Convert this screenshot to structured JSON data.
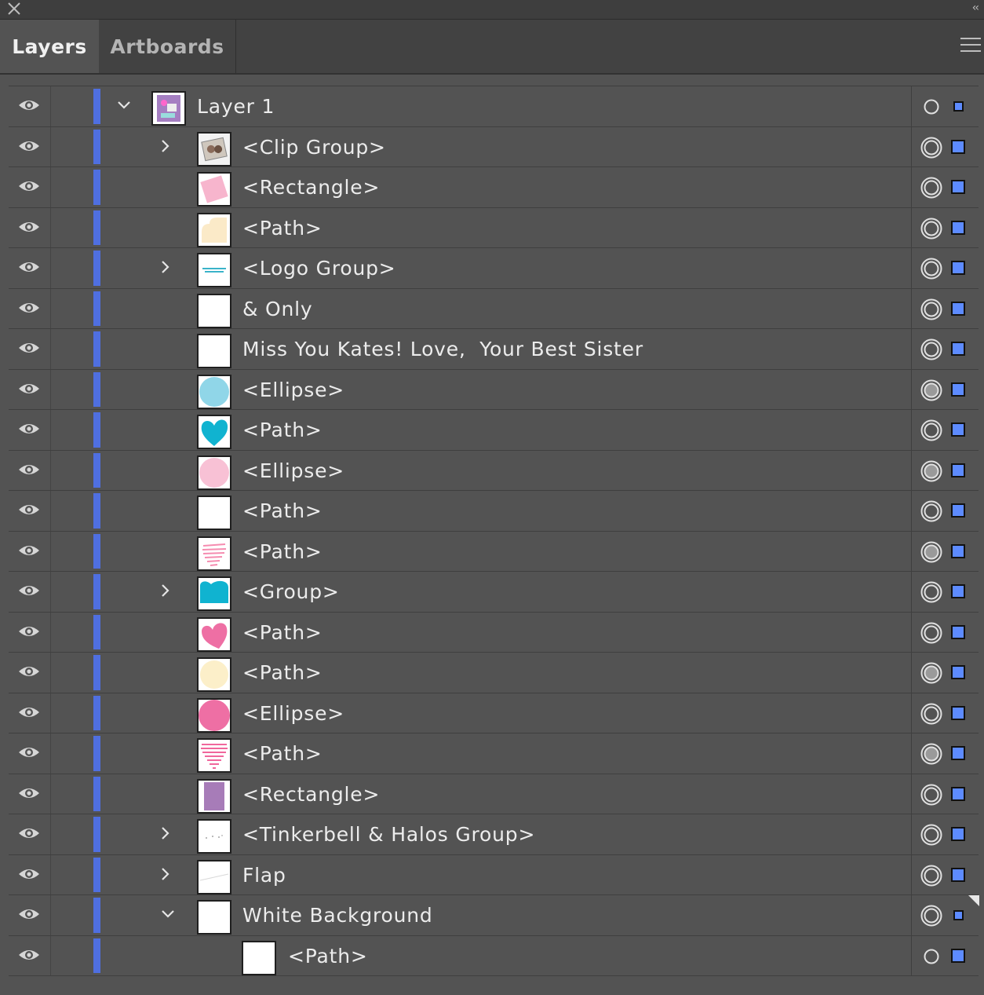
{
  "panel": {
    "tabs": [
      {
        "label": "Layers",
        "active": true
      },
      {
        "label": "Artboards",
        "active": false
      }
    ],
    "collapse_label": "‹‹",
    "accent_color": "#4f6fe0",
    "selection_color": "#5d8bff"
  },
  "rows": [
    {
      "label": "Layer 1",
      "level": 0,
      "expander": "expanded",
      "thumb": "layer",
      "target": "small",
      "sel": "small"
    },
    {
      "label": "<Clip Group>",
      "level": 1,
      "expander": "collapsed",
      "thumb": "photo",
      "target": "ring",
      "sel": "normal"
    },
    {
      "label": "<Rectangle>",
      "level": 1,
      "expander": "none",
      "thumb": "pink-rect",
      "target": "ring",
      "sel": "normal"
    },
    {
      "label": "<Path>",
      "level": 1,
      "expander": "none",
      "thumb": "cream-heart",
      "target": "ring",
      "sel": "normal"
    },
    {
      "label": "<Logo Group>",
      "level": 1,
      "expander": "collapsed",
      "thumb": "logo",
      "target": "ring",
      "sel": "normal"
    },
    {
      "label": "& Only",
      "level": 1,
      "expander": "none",
      "thumb": "blank",
      "target": "ring",
      "sel": "normal"
    },
    {
      "label": "Miss You Kates! Love,  Your Best Sister",
      "level": 1,
      "expander": "none",
      "thumb": "blank",
      "target": "ring",
      "sel": "normal"
    },
    {
      "label": "<Ellipse>",
      "level": 1,
      "expander": "none",
      "thumb": "light-blue-circle",
      "target": "filled",
      "sel": "normal"
    },
    {
      "label": "<Path>",
      "level": 1,
      "expander": "none",
      "thumb": "blue-heart",
      "target": "ring",
      "sel": "normal"
    },
    {
      "label": "<Ellipse>",
      "level": 1,
      "expander": "none",
      "thumb": "light-pink-circle",
      "target": "filled",
      "sel": "normal"
    },
    {
      "label": "<Path>",
      "level": 1,
      "expander": "none",
      "thumb": "blank",
      "target": "ring",
      "sel": "normal"
    },
    {
      "label": "<Path>",
      "level": 1,
      "expander": "none",
      "thumb": "pink-scribble",
      "target": "filled",
      "sel": "normal"
    },
    {
      "label": "<Group>",
      "level": 1,
      "expander": "collapsed",
      "thumb": "blue-heart-wide",
      "target": "ring",
      "sel": "normal"
    },
    {
      "label": "<Path>",
      "level": 1,
      "expander": "none",
      "thumb": "pink-heart",
      "target": "ring",
      "sel": "normal"
    },
    {
      "label": "<Path>",
      "level": 1,
      "expander": "none",
      "thumb": "cream-circle",
      "target": "filled",
      "sel": "normal"
    },
    {
      "label": "<Ellipse>",
      "level": 1,
      "expander": "none",
      "thumb": "hot-pink-circle",
      "target": "ring",
      "sel": "normal"
    },
    {
      "label": "<Path>",
      "level": 1,
      "expander": "none",
      "thumb": "pink-scribble-heart",
      "target": "filled",
      "sel": "normal"
    },
    {
      "label": "<Rectangle>",
      "level": 1,
      "expander": "none",
      "thumb": "purple-rect",
      "target": "ring",
      "sel": "normal"
    },
    {
      "label": "<Tinkerbell & Halos Group>",
      "level": 1,
      "expander": "collapsed",
      "thumb": "dots",
      "target": "ring",
      "sel": "normal"
    },
    {
      "label": "Flap",
      "level": 1,
      "expander": "collapsed",
      "thumb": "flap",
      "target": "ring",
      "sel": "normal"
    },
    {
      "label": "White Background",
      "level": 1,
      "expander": "expanded",
      "thumb": "blank",
      "target": "ring",
      "sel": "small",
      "flag": true
    },
    {
      "label": "<Path>",
      "level": 2,
      "expander": "none",
      "thumb": "blank",
      "target": "small",
      "sel": "normal"
    }
  ]
}
